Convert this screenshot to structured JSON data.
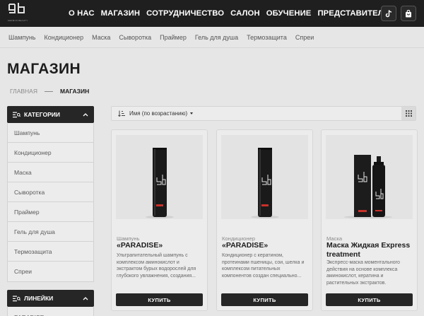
{
  "header": {
    "logo_caption": "GERMAN BEAUTY",
    "nav": [
      {
        "label": "О НАС"
      },
      {
        "label": "МАГАЗИН"
      },
      {
        "label": "СОТРУДНИЧЕСТВО"
      },
      {
        "label": "САЛОН"
      },
      {
        "label": "ОБУЧЕНИЕ"
      },
      {
        "label": "ПРЕДСТАВИТЕЛИ"
      }
    ],
    "icons": {
      "tiktok": "tiktok-icon",
      "cart": "shopping-bag-icon"
    }
  },
  "category_bar": [
    {
      "label": "Шампунь"
    },
    {
      "label": "Кондиционер"
    },
    {
      "label": "Маска"
    },
    {
      "label": "Сыворотка"
    },
    {
      "label": "Праймер"
    },
    {
      "label": "Гель для душа"
    },
    {
      "label": "Термозащита"
    },
    {
      "label": "Спреи"
    }
  ],
  "page": {
    "title": "МАГАЗИН",
    "breadcrumb": {
      "home": "ГЛАВНАЯ",
      "current": "МАГАЗИН"
    }
  },
  "sidebar": {
    "categories_title": "КАТЕГОРИИ",
    "categories": [
      {
        "label": "Шампунь"
      },
      {
        "label": "Кондиционер"
      },
      {
        "label": "Маска"
      },
      {
        "label": "Сыворотка"
      },
      {
        "label": "Праймер"
      },
      {
        "label": "Гель для душа"
      },
      {
        "label": "Термозащита"
      },
      {
        "label": "Спреи"
      }
    ],
    "lines_title": "ЛИНЕЙКИ",
    "lines": [
      {
        "label": "PARADISE"
      }
    ]
  },
  "sort": {
    "label": "Имя (по возрастанию)"
  },
  "products": [
    {
      "category": "Шампунь",
      "name": "«PARADISE»",
      "description": "Ультрапитательный шампунь с комплексом аминокислот и экстрактом бурых водорослей для глубокого увлажнения, создания...",
      "buy_label": "КУПИТЬ"
    },
    {
      "category": "Кондиционер",
      "name": "«PARADISE»",
      "description": "Кондиционер с кератином, протеинами пшеницы, сои, шелка и комплексом питательных компонентов создан специально...",
      "buy_label": "КУПИТЬ"
    },
    {
      "category": "Маска",
      "name": "Маска Жидкая Express treatment",
      "description": "Экспресс-маска моментального действия на основе комплекса аминокислот, кератина и растительных экстрактов.",
      "buy_label": "КУПИТЬ"
    }
  ],
  "colors": {
    "header_bg": "#1f1f1f",
    "button_bg": "#262626",
    "page_bg": "#e6e6e6",
    "bottle_accent": "#c8302a"
  }
}
